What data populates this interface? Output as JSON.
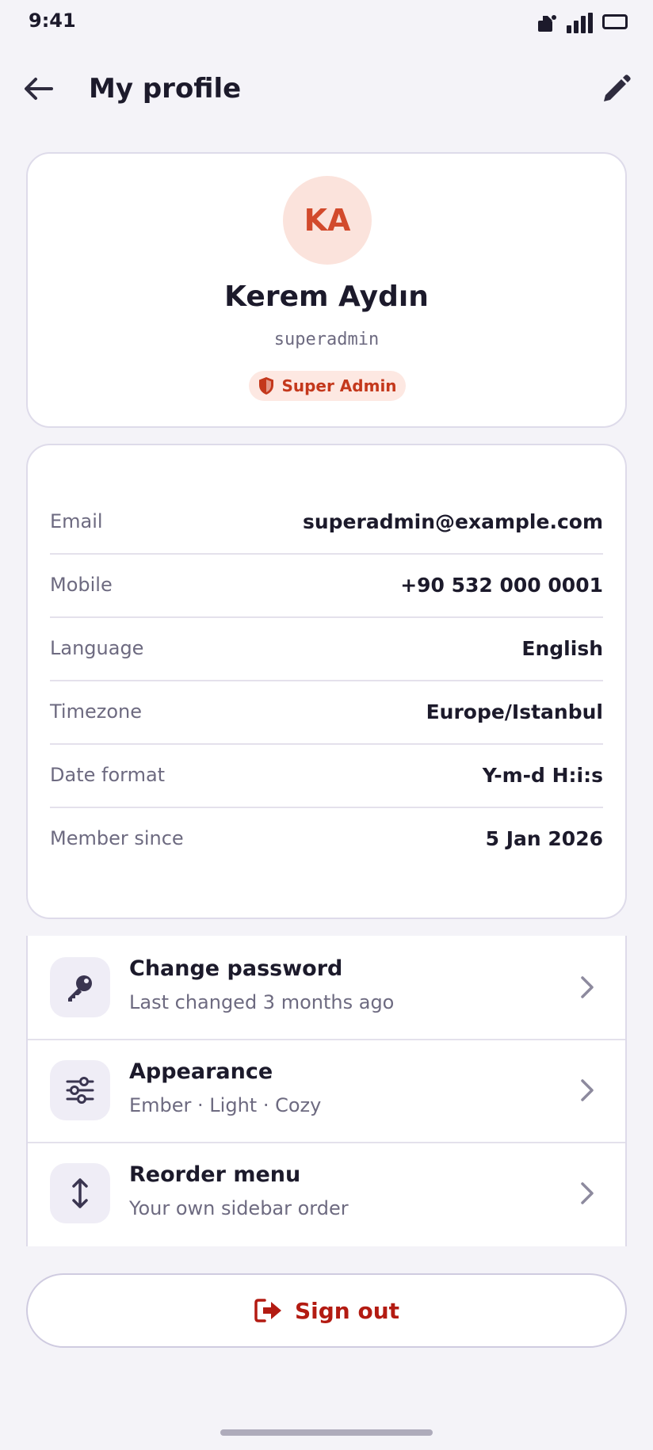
{
  "status_bar": {
    "time": "9:41"
  },
  "header": {
    "title": "My profile"
  },
  "profile": {
    "initials": "KA",
    "name": "Kerem Aydın",
    "username": "superadmin",
    "role": "Super Admin"
  },
  "details": [
    {
      "label": "Email",
      "value": "superadmin@example.com"
    },
    {
      "label": "Mobile",
      "value": "+90 532 000 0001"
    },
    {
      "label": "Language",
      "value": "English"
    },
    {
      "label": "Timezone",
      "value": "Europe/Istanbul"
    },
    {
      "label": "Date format",
      "value": "Y-m-d H:i:s"
    },
    {
      "label": "Member since",
      "value": "5 Jan 2026"
    }
  ],
  "actions": [
    {
      "title": "Change password",
      "subtitle": "Last changed 3 months ago",
      "icon": "key-icon"
    },
    {
      "title": "Appearance",
      "subtitle": "Ember · Light · Cozy",
      "icon": "sliders-icon"
    },
    {
      "title": "Reorder menu",
      "subtitle": "Your own sidebar order",
      "icon": "reorder-icon"
    }
  ],
  "sign_out": {
    "label": "Sign out"
  },
  "colors": {
    "accent": "#d24a2c",
    "danger": "#b31b12",
    "background": "#f4f3f8"
  }
}
